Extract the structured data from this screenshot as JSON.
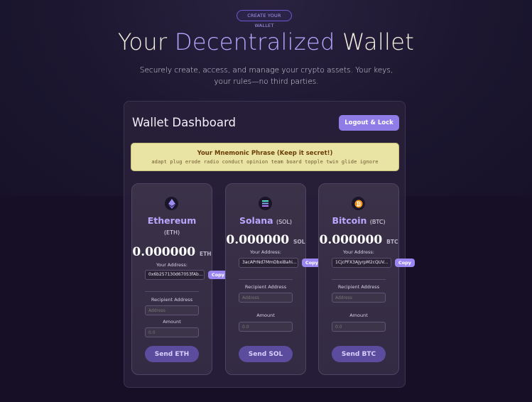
{
  "header": {
    "pill": "CREATE YOUR WALLET",
    "title_part1": "Your ",
    "title_accent": "Decentralized",
    "title_part2": " Wallet",
    "subtitle": "Securely create, access, and manage your crypto assets. Your keys, your rules—no third parties."
  },
  "dashboard": {
    "title": "Wallet Dashboard",
    "logout_label": "Logout & Lock",
    "mnemonic_title": "Your Mnemonic Phrase (Keep it secret!)",
    "mnemonic_words": "adapt plug erode radio conduct opinion team board topple twin glide ignore"
  },
  "wallets": [
    {
      "name": "Ethereum",
      "symbol": "(ETH)",
      "balance": "0.000000",
      "unit": "ETH",
      "address_label": "Your Address:",
      "address": "0x6b257130d67053fAb0...",
      "copy_label": "Copy",
      "recipient_label": "Recipient Address",
      "recipient_placeholder": "Address",
      "amount_label": "Amount",
      "amount_placeholder": "0.0",
      "send_label": "Send ETH",
      "icon": "ethereum-icon"
    },
    {
      "name": "Solana",
      "symbol": "(SOL)",
      "balance": "0.000000",
      "unit": "SOL",
      "address_label": "Your Address:",
      "address": "3acAPrNd7MmDbxiBahi...",
      "copy_label": "Copy",
      "recipient_label": "Recipient Address",
      "recipient_placeholder": "Address",
      "amount_label": "Amount",
      "amount_placeholder": "0.0",
      "send_label": "Send SOL",
      "icon": "solana-icon"
    },
    {
      "name": "Bitcoin",
      "symbol": "(BTC)",
      "balance": "0.000000",
      "unit": "BTC",
      "address_label": "Your Address:",
      "address": "1CjcPFX3AJyrpM2cQUV...",
      "copy_label": "Copy",
      "recipient_label": "Recipient Address",
      "recipient_placeholder": "Address",
      "amount_label": "Amount",
      "amount_placeholder": "0.0",
      "send_label": "Send BTC",
      "icon": "bitcoin-icon"
    }
  ],
  "colors": {
    "accent": "#b8a6ff",
    "button": "#8f7ce6",
    "mnemonic_bg": "#e9e3a4",
    "background": "#140f22"
  }
}
